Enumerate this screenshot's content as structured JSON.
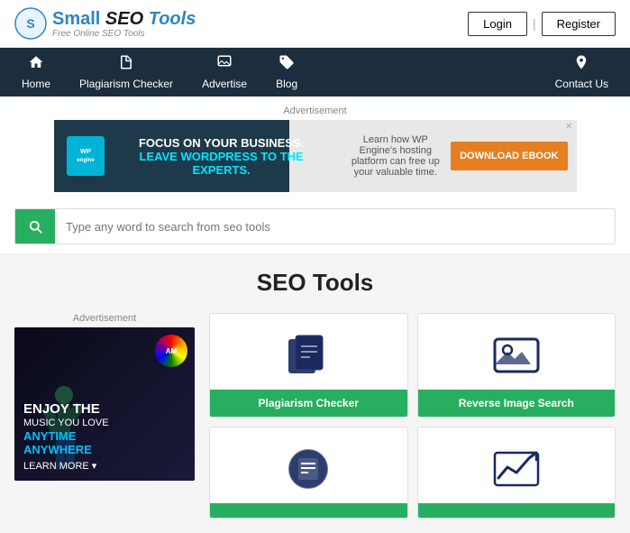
{
  "header": {
    "logo_small": "Small",
    "logo_seo": "SEO",
    "logo_tools": "Tools",
    "logo_sub": "Free Online SEO Tools",
    "login_label": "Login",
    "register_label": "Register",
    "separator": "|"
  },
  "navbar": {
    "items": [
      {
        "id": "home",
        "label": "Home",
        "icon": "home"
      },
      {
        "id": "plagiarism",
        "label": "Plagiarism Checker",
        "icon": "file"
      },
      {
        "id": "advertise",
        "label": "Advertise",
        "icon": "image"
      },
      {
        "id": "blog",
        "label": "Blog",
        "icon": "tag"
      }
    ],
    "contact": {
      "label": "Contact Us",
      "icon": "pin"
    }
  },
  "ad_banner": {
    "label": "Advertisement",
    "wp_logo": "WP\nengine",
    "focus_text": "FOCUS ON YOUR BUSINESS.",
    "leave_text": "LEAVE WORDPRESS TO THE EXPERTS.",
    "right_text": "Learn how WP Engine's hosting platform can free up your valuable time.",
    "download_label": "DOWNLOAD EBOOK",
    "close": "✕"
  },
  "search": {
    "placeholder": "Type any word to search from seo tools"
  },
  "seo_section": {
    "title": "SEO Tools"
  },
  "left_ad": {
    "label": "Advertisement",
    "badge": "AM",
    "enjoy": "ENJOY THE",
    "music": "MUSIC YOU LOVE",
    "anytime": "ANYTIME",
    "anywhere": "ANYWHERE",
    "learn": "LEARN MORE ▾"
  },
  "tool_cards": [
    {
      "id": "plagiarism-checker",
      "label": "Plagiarism Checker",
      "icon": "files"
    },
    {
      "id": "reverse-image-search",
      "label": "Reverse Image Search",
      "icon": "image-search"
    },
    {
      "id": "tool3",
      "label": "",
      "icon": "document-edit"
    },
    {
      "id": "tool4",
      "label": "",
      "icon": "trending-up"
    }
  ]
}
